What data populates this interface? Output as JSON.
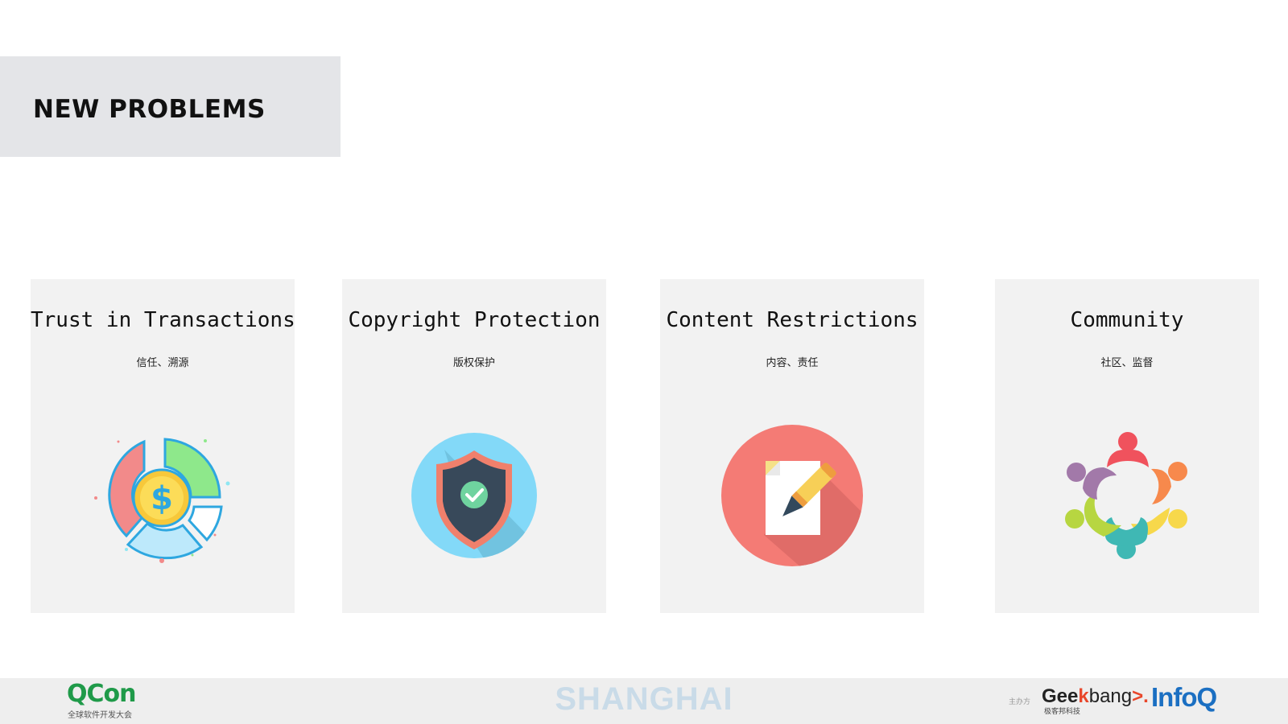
{
  "header": {
    "title": "NEW PROBLEMS"
  },
  "cards": [
    {
      "title": "Trust in Transactions",
      "subtitle": "信任、溯源",
      "icon": "dollar-pie-chart-icon"
    },
    {
      "title": "Copyright Protection",
      "subtitle": "版权保护",
      "icon": "shield-check-icon"
    },
    {
      "title": "Content Restrictions",
      "subtitle": "内容、责任",
      "icon": "document-pen-icon"
    },
    {
      "title": "Community",
      "subtitle": "社区、监督",
      "icon": "people-circle-icon"
    }
  ],
  "footer": {
    "brand": "QCon",
    "brand_sub": "全球软件开发大会",
    "city": "SHANGHAI",
    "organizer_label": "主办方",
    "geek_prefix": "Gee",
    "geek_k": "k",
    "geek_suffix": "bang",
    "geek_arrow": ">.",
    "geek_sub": "极客邦科技",
    "infoq": "InfoQ"
  },
  "colors": {
    "title_box": "#e4e5e8",
    "card_bg": "#f2f2f2",
    "footer_bg": "#eeeeee",
    "qcon_green": "#1f9a49",
    "infoq_blue": "#1b6fc2",
    "geek_orange": "#e8462a"
  }
}
